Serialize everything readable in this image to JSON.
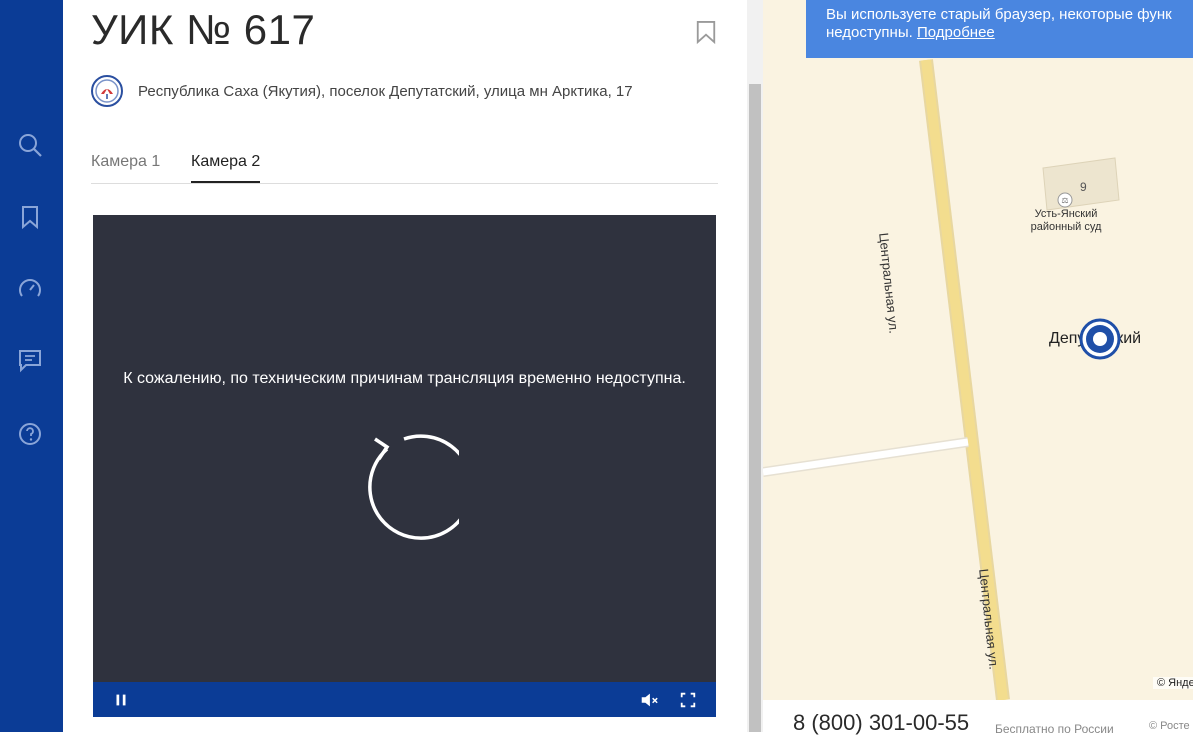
{
  "sidebar": {
    "icons": [
      "search-icon",
      "bookmark-icon",
      "speedometer-icon",
      "chat-icon",
      "help-icon"
    ]
  },
  "panel": {
    "title": "УИК № 617",
    "address": "Республика Саха (Якутия), поселок Депутатский, улица мн Арктика, 17",
    "tabs": [
      {
        "label": "Камера 1",
        "active": false
      },
      {
        "label": "Камера 2",
        "active": true
      }
    ]
  },
  "player": {
    "message": "К сожалению, по техническим причинам трансляция временно недоступна."
  },
  "banner": {
    "line1": "Вы используете старый браузер, некоторые функ",
    "line2": "недоступны.",
    "link": "Подробнее"
  },
  "map": {
    "building_number": "9",
    "poi_label": "Усть-Янский районный суд",
    "street_top": "Центральная ул.",
    "street_bottom": "Центральная ул.",
    "place_label": "Депутатский",
    "copyright": "© Янде"
  },
  "footer": {
    "phone": "8 (800) 301-00-55",
    "free_text": "Бесплатно по России",
    "copyright": "© Росте"
  },
  "colors": {
    "brand_blue": "#0b3c96",
    "banner_blue": "#4a86e0",
    "player_bg": "#2f323e",
    "map_bg": "#faf3e1",
    "road": "#f3dd8e"
  }
}
